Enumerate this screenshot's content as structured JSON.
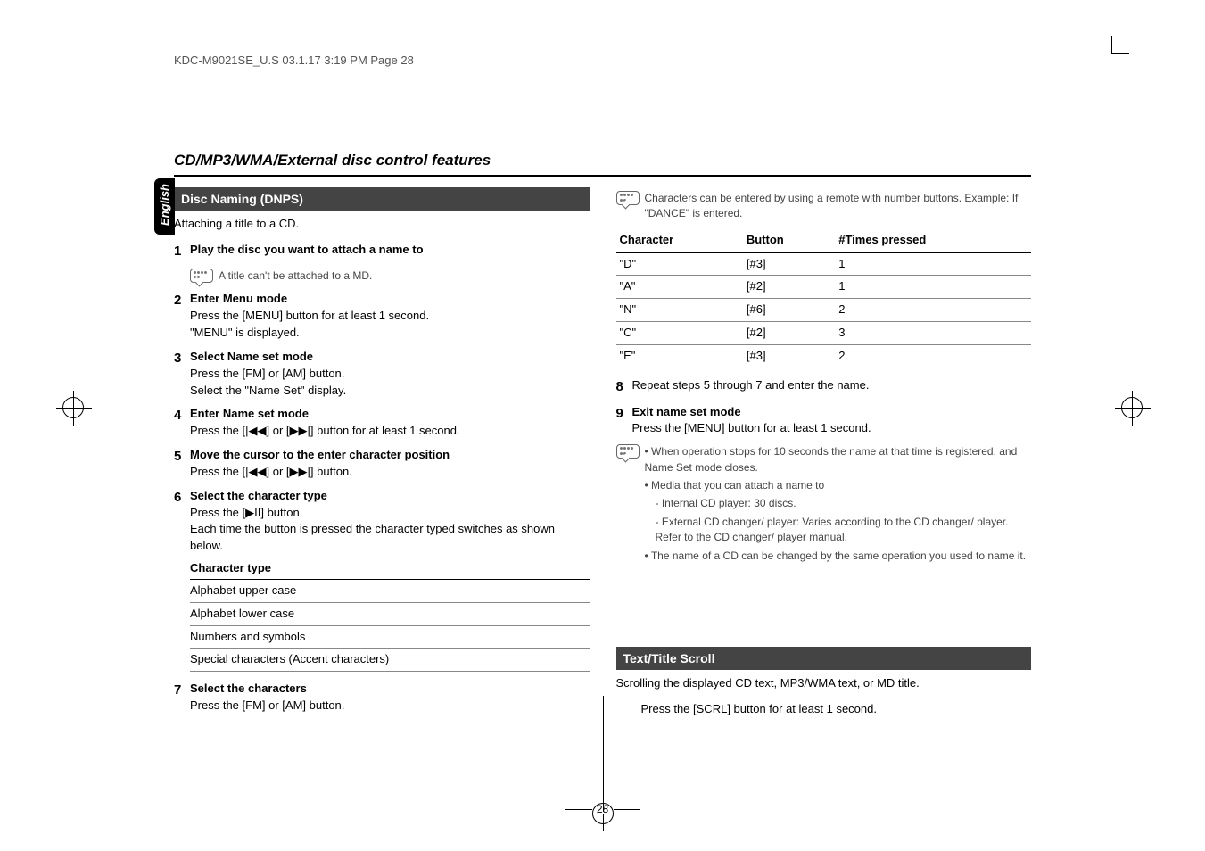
{
  "header": "KDC-M9021SE_U.S  03.1.17  3:19 PM  Page 28",
  "sidebar": "English",
  "sectionTitle": "CD/MP3/WMA/External disc control features",
  "left": {
    "heading1": "Disc Naming (DNPS)",
    "intro1": "Attaching a title to a CD.",
    "step1": {
      "num": "1",
      "title": "Play the disc you want to attach a name to"
    },
    "note1": "A title can't be attached to a MD.",
    "step2": {
      "num": "2",
      "title": "Enter Menu mode",
      "l1": "Press the [MENU] button for at least 1 second.",
      "l2": "\"MENU\" is displayed."
    },
    "step3": {
      "num": "3",
      "title": "Select Name set mode",
      "l1": "Press the [FM] or [AM] button.",
      "l2": "Select the \"Name Set\" display."
    },
    "step4": {
      "num": "4",
      "title": "Enter Name set mode",
      "l1": "Press the [|◀◀] or [▶▶|] button for at least 1 second."
    },
    "step5": {
      "num": "5",
      "title": "Move the cursor to the enter character position",
      "l1": "Press the [|◀◀] or [▶▶|] button."
    },
    "step6": {
      "num": "6",
      "title": "Select the character type",
      "l1": "Press the [▶II] button.",
      "l2": "Each time the button is pressed the character typed switches as shown below."
    },
    "charTypeHead": "Character type",
    "charTypes": [
      "Alphabet upper case",
      "Alphabet lower case",
      "Numbers and symbols",
      "Special characters (Accent characters)"
    ],
    "step7": {
      "num": "7",
      "title": "Select the characters",
      "l1": "Press the [FM] or [AM] button."
    }
  },
  "right": {
    "topNote": "Characters can be entered by using a remote with number buttons. Example: If \"DANCE\" is entered.",
    "tableHead": {
      "c1": "Character",
      "c2": "Button",
      "c3": "#Times pressed"
    },
    "tableRows": [
      {
        "c": "\"D\"",
        "b": "[#3]",
        "t": "1"
      },
      {
        "c": "\"A\"",
        "b": "[#2]",
        "t": "1"
      },
      {
        "c": "\"N\"",
        "b": "[#6]",
        "t": "2"
      },
      {
        "c": "\"C\"",
        "b": "[#2]",
        "t": "3"
      },
      {
        "c": "\"E\"",
        "b": "[#3]",
        "t": "2"
      }
    ],
    "step8": {
      "num": "8",
      "text": "Repeat steps 5 through 7 and enter the name."
    },
    "step9": {
      "num": "9",
      "title": "Exit name set mode",
      "l1": "Press the [MENU] button for at least 1 second."
    },
    "bullets": [
      "When operation stops for 10 seconds the name at that time is registered, and Name Set mode closes.",
      "Media that you can attach a name to",
      "- Internal CD player: 30 discs.",
      "- External CD changer/ player: Varies according to the CD changer/ player. Refer to the CD changer/ player manual.",
      "The name of a CD can be changed by the same operation you used to name it."
    ],
    "heading2": "Text/Title Scroll",
    "intro2": "Scrolling the displayed CD text, MP3/WMA text, or MD title.",
    "scrollStep": "Press the [SCRL] button for at least 1 second."
  },
  "pageNum": "28"
}
